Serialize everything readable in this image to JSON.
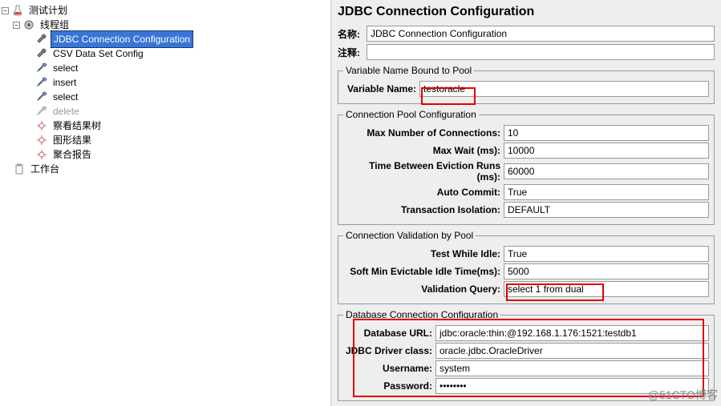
{
  "tree": {
    "root": "测试计划",
    "group": "线程组",
    "items": [
      "JDBC Connection Configuration",
      "CSV Data Set Config",
      "select",
      "insert",
      "select",
      "delete",
      "察看结果树",
      "图形结果",
      "聚合报告"
    ],
    "workbench": "工作台"
  },
  "title": "JDBC Connection Configuration",
  "name_label": "名称:",
  "name_value": "JDBC Connection Configuration",
  "comment_label": "注释:",
  "comment_value": "",
  "varpool": {
    "legend": "Variable Name Bound to Pool",
    "var_label": "Variable Name:",
    "var_value": "testoracle"
  },
  "connpool": {
    "legend": "Connection Pool Configuration",
    "max_conn_label": "Max Number of Connections:",
    "max_conn_value": "10",
    "max_wait_label": "Max Wait (ms):",
    "max_wait_value": "10000",
    "evict_label": "Time Between Eviction Runs (ms):",
    "evict_value": "60000",
    "auto_label": "Auto Commit:",
    "auto_value": "True",
    "iso_label": "Transaction Isolation:",
    "iso_value": "DEFAULT"
  },
  "valid": {
    "legend": "Connection Validation by Pool",
    "idle_label": "Test While Idle:",
    "idle_value": "True",
    "min_evict_label": "Soft Min Evictable Idle Time(ms):",
    "min_evict_value": "5000",
    "query_label": "Validation Query:",
    "query_value": "select 1 from dual"
  },
  "db": {
    "legend": "Database Connection Configuration",
    "url_label": "Database URL:",
    "url_value": "jdbc:oracle:thin:@192.168.1.176:1521:testdb1",
    "driver_label": "JDBC Driver class:",
    "driver_value": "oracle.jdbc.OracleDriver",
    "user_label": "Username:",
    "user_value": "system",
    "pass_label": "Password:",
    "pass_value": "••••••••"
  },
  "watermark": "@51CTO博客"
}
